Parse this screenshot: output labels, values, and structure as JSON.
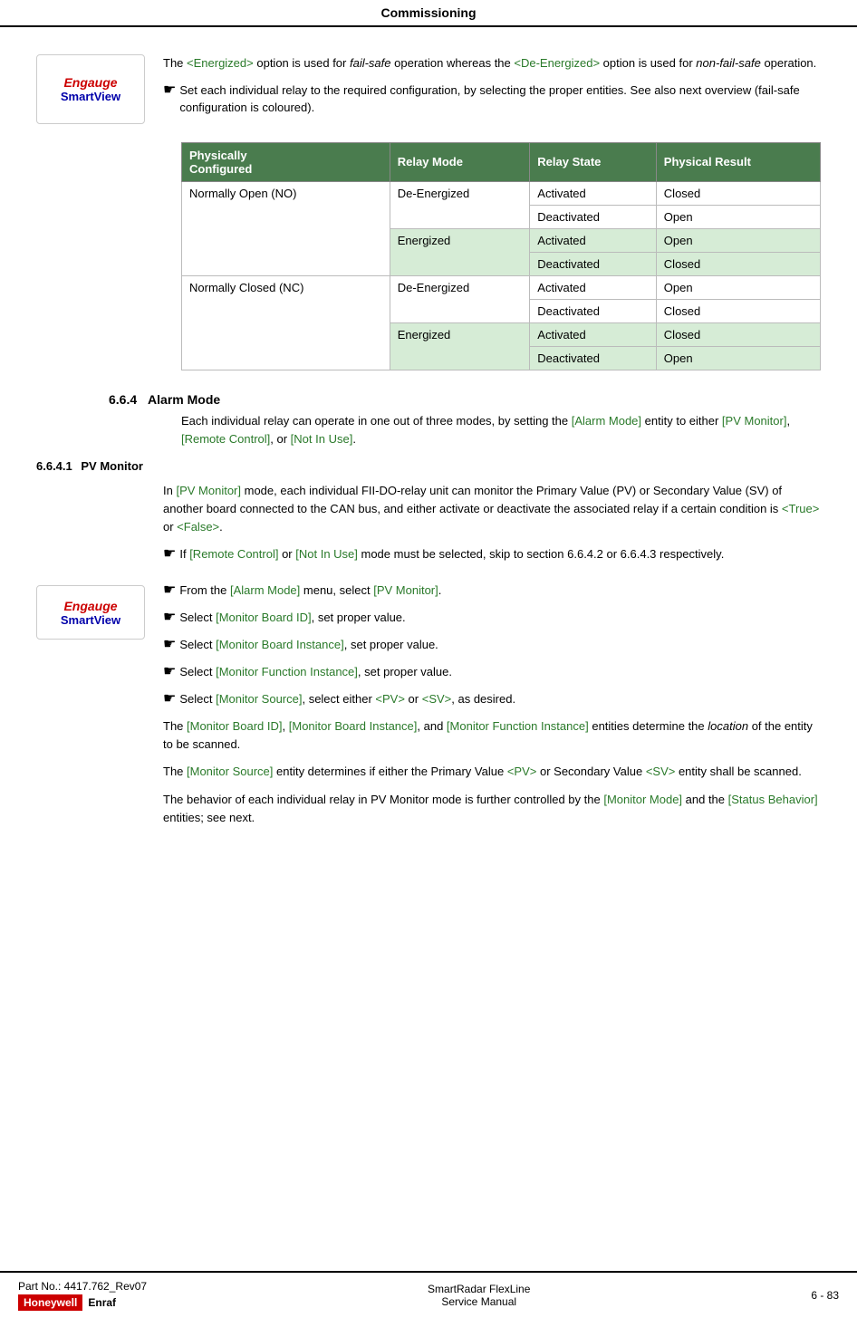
{
  "header": {
    "title": "Commissioning"
  },
  "intro": {
    "energized_link": "<Energized>",
    "deenergized_link": "<De-Energized>",
    "paragraph1": "The <Energized> option is used for fail-safe operation whereas the <De-Energized> option is used for non-fail-safe operation.",
    "bullet1": "Set each individual relay to the required configuration, by selecting the proper entities. See also next overview (fail-safe configuration is coloured)."
  },
  "table": {
    "headers": [
      "Physically Configured",
      "Relay Mode",
      "Relay State",
      "Physical Result"
    ],
    "rows": [
      {
        "physConfig": "Normally Open (NO)",
        "relayMode": "De-Energized",
        "relayState": "Activated",
        "physResult": "Closed",
        "green": false
      },
      {
        "physConfig": "",
        "relayMode": "",
        "relayState": "Deactivated",
        "physResult": "Open",
        "green": false
      },
      {
        "physConfig": "",
        "relayMode": "Energized",
        "relayState": "Activated",
        "physResult": "Open",
        "green": true
      },
      {
        "physConfig": "",
        "relayMode": "",
        "relayState": "Deactivated",
        "physResult": "Closed",
        "green": true
      },
      {
        "physConfig": "Normally Closed (NC)",
        "relayMode": "De-Energized",
        "relayState": "Activated",
        "physResult": "Open",
        "green": false
      },
      {
        "physConfig": "",
        "relayMode": "",
        "relayState": "Deactivated",
        "physResult": "Closed",
        "green": false
      },
      {
        "physConfig": "",
        "relayMode": "Energized",
        "relayState": "Activated",
        "physResult": "Closed",
        "green": true
      },
      {
        "physConfig": "",
        "relayMode": "",
        "relayState": "Deactivated",
        "physResult": "Open",
        "green": true
      }
    ]
  },
  "section664": {
    "number": "6.6.4",
    "title": "Alarm Mode",
    "body": "Each individual relay can operate in one out of three modes, by setting the [Alarm Mode] entity to either [PV Monitor], [Remote Control], or [Not In Use]."
  },
  "section6641": {
    "number": "6.6.4.1",
    "title": "PV Monitor",
    "para1": "In [PV Monitor] mode, each individual FII-DO-relay unit can monitor the Primary Value (PV) or Secondary Value (SV) of another board connected to the CAN bus, and either activate or deactivate the associated relay if a certain condition is <True> or <False>.",
    "bullet1": "If [Remote Control] or [Not In Use] mode must be selected, skip to section 6.6.4.2 or 6.6.4.3 respectively.",
    "bullet2": "From the [Alarm Mode] menu, select [PV Monitor].",
    "bullet3": "Select [Monitor Board ID], set proper value.",
    "bullet4": "Select [Monitor Board Instance], set proper value.",
    "bullet5": "Select [Monitor Function Instance], set proper value.",
    "bullet6": "Select [Monitor Source], select either <PV> or <SV>, as desired.",
    "para2": "The [Monitor Board ID], [Monitor Board Instance], and [Monitor Function Instance] entities determine the location of the entity to be scanned.",
    "para3": "The [Monitor Source] entity determines if either the Primary Value <PV> or Secondary Value <SV> entity shall be scanned.",
    "para4": "The behavior of each individual relay in PV Monitor mode is further controlled by the [Monitor Mode] and the [Status Behavior] entities; see next."
  },
  "footer": {
    "partNo": "Part No.: 4417.762_Rev07",
    "productName": "SmartRadar FlexLine",
    "docType": "Service Manual",
    "pageRef": "6 - 83",
    "honeywell": "Honeywell",
    "enraf": "Enraf"
  },
  "logo": {
    "top": "Engauge",
    "bottom": "SmartView"
  }
}
